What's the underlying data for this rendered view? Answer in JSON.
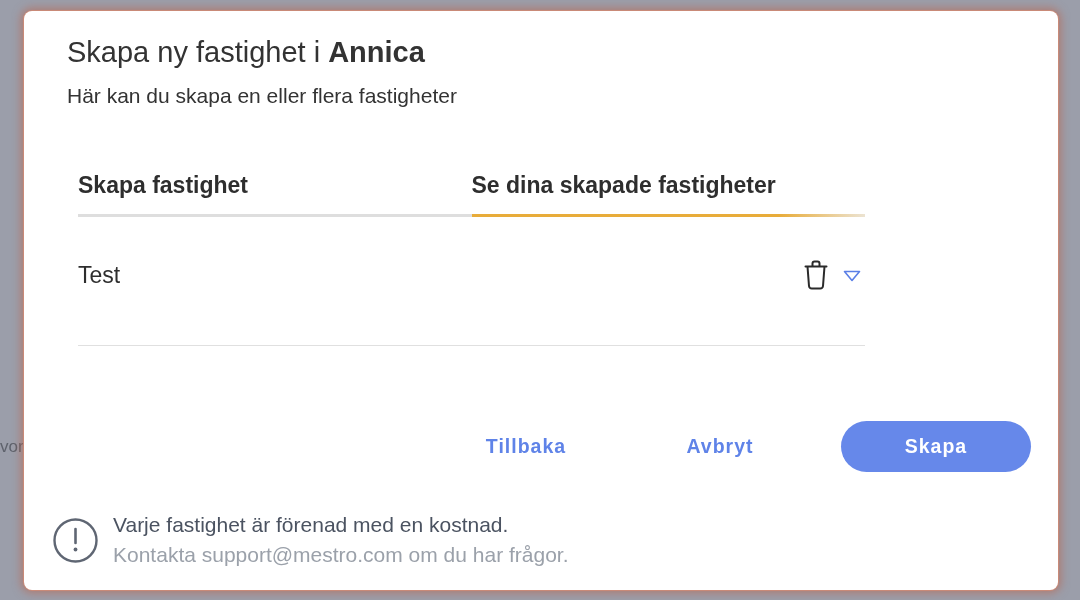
{
  "backdrop": {
    "text": "vor"
  },
  "dialog": {
    "title": "Skapa ny fastighet i **Annica**",
    "subtitle": "Här kan du skapa en eller flera fastigheter"
  },
  "tabs": [
    {
      "label": "Skapa fastighet",
      "selected": false
    },
    {
      "label": "Se dina skapade fastigheter",
      "selected": true
    }
  ],
  "properties": [
    {
      "name": "Test",
      "expanded": false
    }
  ],
  "buttons": [
    {
      "label": "Tillbaka",
      "kind": "text"
    },
    {
      "label": "Avbryt",
      "kind": "text"
    },
    {
      "label": "Skapa",
      "kind": "primary"
    }
  ],
  "notice": {
    "message": "Varje fastighet är förenad med en kostnad.",
    "contact": "Kontakta support@mestro.com om du har frågor."
  }
}
